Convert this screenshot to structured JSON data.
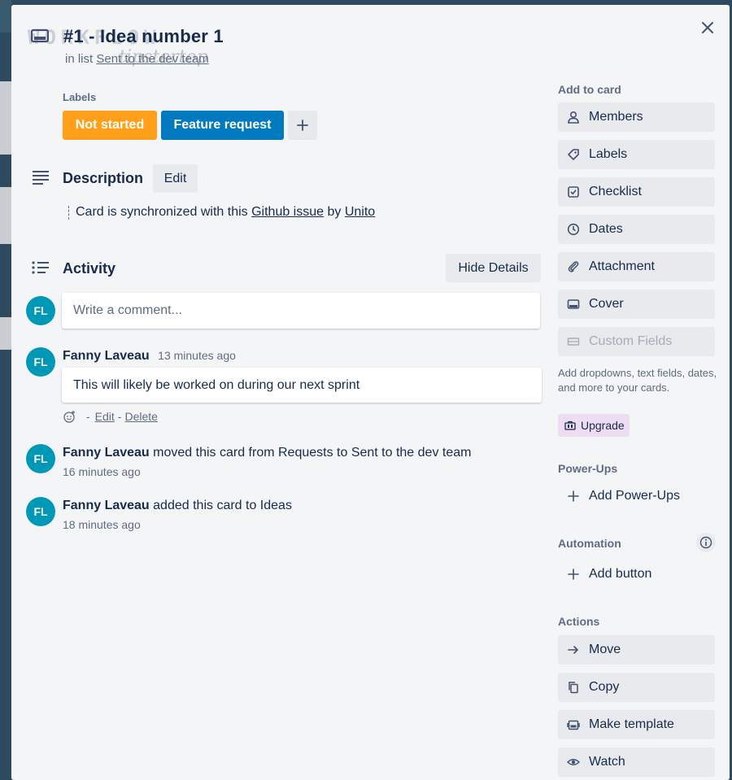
{
  "card": {
    "title": "#1 - Idea number 1",
    "in_list_prefix": "in list",
    "list_name": "Sent to the dev team",
    "watermark_brand": "WORKFLOW",
    "watermark_sub": "tipstertop"
  },
  "labels": {
    "heading": "Labels",
    "items": [
      {
        "text": "Not started",
        "color": "#ff9f1a"
      },
      {
        "text": "Feature request",
        "color": "#0079bf"
      }
    ],
    "add_icon": "plus-icon"
  },
  "description": {
    "heading": "Description",
    "edit_label": "Edit",
    "text_before": "Card is synchronized with this",
    "link1": "Github issue",
    "text_mid": "by",
    "link2": "Unito"
  },
  "activity": {
    "heading": "Activity",
    "hide_details_label": "Hide Details",
    "comment_placeholder": "Write a comment...",
    "avatar_initials": "FL",
    "items": [
      {
        "author": "Fanny Laveau",
        "time": "13 minutes ago",
        "comment": "This will likely be worked on during our next sprint",
        "sep": "-",
        "edit": "Edit",
        "delete": "Delete"
      },
      {
        "author": "Fanny Laveau",
        "text": "moved this card from Requests to Sent to the dev team",
        "time": "16 minutes ago"
      },
      {
        "author": "Fanny Laveau",
        "text": "added this card to Ideas",
        "time": "18 minutes ago"
      }
    ]
  },
  "sidebar": {
    "add_to_card": "Add to card",
    "add_items": [
      {
        "label": "Members",
        "icon": "person-icon"
      },
      {
        "label": "Labels",
        "icon": "tag-icon"
      },
      {
        "label": "Checklist",
        "icon": "checkbox-icon"
      },
      {
        "label": "Dates",
        "icon": "clock-icon"
      },
      {
        "label": "Attachment",
        "icon": "paperclip-icon"
      },
      {
        "label": "Cover",
        "icon": "card-icon"
      },
      {
        "label": "Custom Fields",
        "icon": "fields-icon"
      }
    ],
    "custom_desc": "Add dropdowns, text fields, dates, and more to your cards.",
    "upgrade_label": "Upgrade",
    "powerups_heading": "Power-Ups",
    "add_powerups": "Add Power-Ups",
    "automation_heading": "Automation",
    "add_button": "Add button",
    "actions_heading": "Actions",
    "actions": [
      {
        "label": "Move",
        "icon": "arrow-right-icon"
      },
      {
        "label": "Copy",
        "icon": "copy-icon"
      },
      {
        "label": "Make template",
        "icon": "template-icon"
      },
      {
        "label": "Watch",
        "icon": "eye-icon"
      }
    ]
  }
}
